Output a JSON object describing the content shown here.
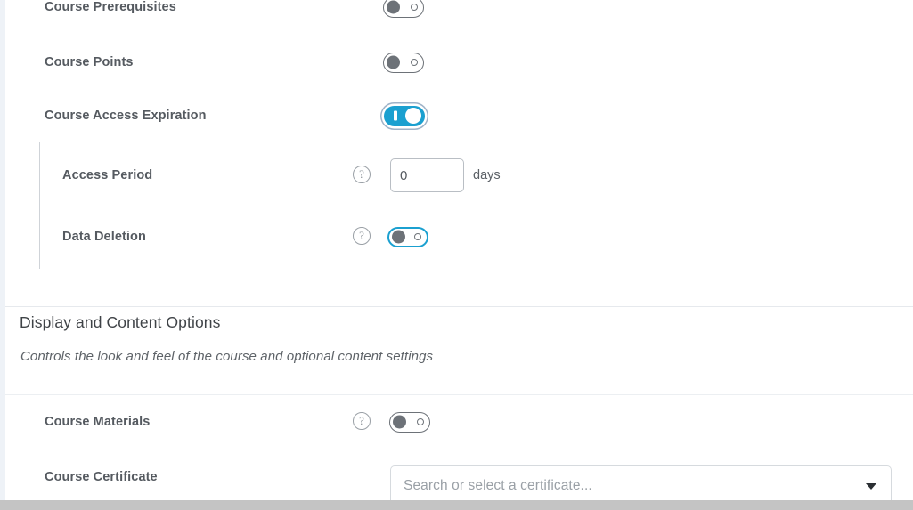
{
  "settings_rows": [
    {
      "id": "course-prerequisites",
      "label": "Course Prerequisites",
      "toggle_state": "off",
      "has_help": false,
      "indented": false
    },
    {
      "id": "course-points",
      "label": "Course Points",
      "toggle_state": "off",
      "has_help": false,
      "indented": false
    },
    {
      "id": "course-access-expiration",
      "label": "Course Access Expiration",
      "toggle_state": "on",
      "has_help": false,
      "indented": false
    },
    {
      "id": "access-period",
      "label": "Access Period",
      "control": "number-input",
      "value": "0",
      "unit": "days",
      "has_help": true,
      "indented": true
    },
    {
      "id": "data-deletion",
      "label": "Data Deletion",
      "toggle_state": "off-focused",
      "has_help": true,
      "indented": true
    }
  ],
  "section": {
    "title": "Display and Content Options",
    "description": "Controls the look and feel of the course and optional content settings",
    "rows": [
      {
        "id": "course-materials",
        "label": "Course Materials",
        "toggle_state": "off",
        "has_help": true
      },
      {
        "id": "course-certificate",
        "label": "Course Certificate",
        "control": "combobox",
        "placeholder": "Search or select a certificate...",
        "has_help": false
      }
    ]
  },
  "icons": {
    "help": "?",
    "dropdown_caret": "chevron-down-icon"
  },
  "colors": {
    "toggle_on": "#1ba0d0",
    "toggle_off": "#6d7278",
    "label_text": "#555a60",
    "section_title": "#3f4347",
    "placeholder": "#9aa0a6"
  }
}
